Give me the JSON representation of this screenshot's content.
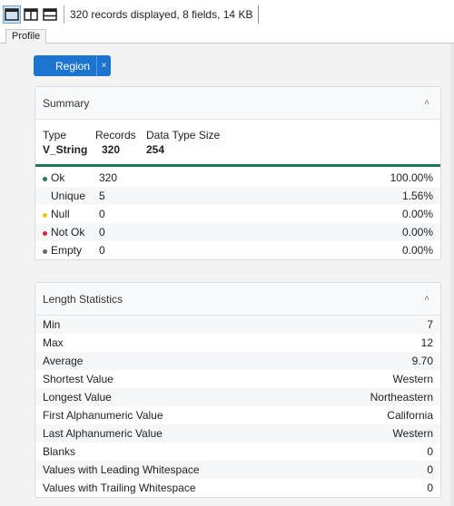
{
  "toolbar": {
    "status": "320 records displayed, 8 fields, 14 KB"
  },
  "tabs": [
    {
      "label": "Profile"
    }
  ],
  "field_chip": {
    "label": "Region",
    "close": "×"
  },
  "summary": {
    "title": "Summary",
    "type_label": "Type",
    "type_value": "V_String",
    "records_label": "Records",
    "records_value": "320",
    "size_label": "Data Type Size",
    "size_value": "254",
    "rows": [
      {
        "label": "Ok",
        "count": "320",
        "pct": "100.00%",
        "dot": "#1e7a52"
      },
      {
        "label": "Unique",
        "count": "5",
        "pct": "1.56%",
        "dot": ""
      },
      {
        "label": "Null",
        "count": "0",
        "pct": "0.00%",
        "dot": "#f0c419"
      },
      {
        "label": "Not Ok",
        "count": "0",
        "pct": "0.00%",
        "dot": "#d7263d"
      },
      {
        "label": "Empty",
        "count": "0",
        "pct": "0.00%",
        "dot": "#666666"
      }
    ]
  },
  "length_stats": {
    "title": "Length Statistics",
    "rows": [
      {
        "label": "Min",
        "value": "7"
      },
      {
        "label": "Max",
        "value": "12"
      },
      {
        "label": "Average",
        "value": "9.70"
      },
      {
        "label": "Shortest Value",
        "value": "Western"
      },
      {
        "label": "Longest Value",
        "value": "Northeastern"
      },
      {
        "label": "First Alphanumeric Value",
        "value": "California"
      },
      {
        "label": "Last Alphanumeric Value",
        "value": "Western"
      },
      {
        "label": "Blanks",
        "value": "0"
      },
      {
        "label": "Values with Leading Whitespace",
        "value": "0"
      },
      {
        "label": "Values with Trailing Whitespace",
        "value": "0"
      }
    ]
  }
}
